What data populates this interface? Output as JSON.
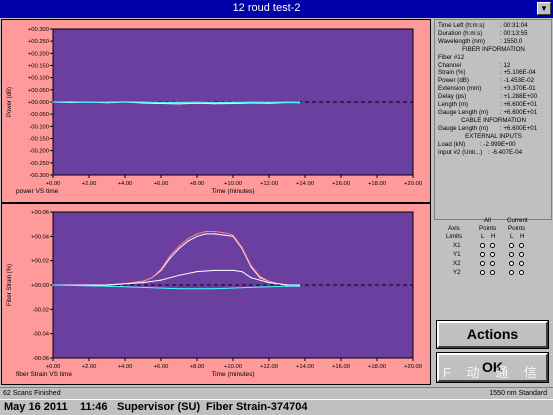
{
  "window": {
    "title": "12 roud test-2"
  },
  "top_chart": {
    "caption": "power VS time",
    "ylabel": "Power (dB)",
    "xlabel": "Time (minutes)",
    "yticks": [
      "+00.300",
      "+00.250",
      "+00.200",
      "+00.150",
      "+00.100",
      "+00.050",
      "+00.000",
      "-00.050",
      "-00.100",
      "-00.150",
      "-00.200",
      "-00.250",
      "-00.300"
    ],
    "xticks": [
      "+0.00",
      "+2.00",
      "+4.00",
      "+6.00",
      "+8.00",
      "+10.00",
      "+12.00",
      "+14.00",
      "+16.00",
      "+18.00",
      "+20.00"
    ]
  },
  "bottom_chart": {
    "caption": "fiber Strain VS time",
    "ylabel": "Fiber Strain (%)",
    "xlabel": "Time (minutes)",
    "yticks": [
      "+00.06",
      "+00.04",
      "+00.02",
      "+00.00",
      "-00.02",
      "-00.04",
      "-00.06"
    ],
    "xticks": [
      "+0.00",
      "+2.00",
      "+4.00",
      "+6.00",
      "+8.00",
      "+10.00",
      "+12.00",
      "+14.00",
      "+16.00",
      "+18.00",
      "+20.00"
    ]
  },
  "chart_data": [
    {
      "type": "line",
      "ylabel": "Power (dB)",
      "xlabel": "Time (minutes)",
      "xlim": [
        0,
        20
      ],
      "ylim": [
        -0.3,
        0.3
      ],
      "series": [
        {
          "color": "#ffffff",
          "x": [
            0,
            1,
            2,
            3,
            4,
            5,
            6,
            7,
            8,
            9,
            10,
            11,
            12,
            13,
            13.7
          ],
          "values": [
            0.0,
            -0.002,
            0.0,
            -0.003,
            0.0,
            -0.004,
            -0.006,
            -0.008,
            -0.005,
            -0.007,
            -0.006,
            -0.004,
            -0.005,
            -0.002,
            -0.003
          ]
        },
        {
          "color": "#ff8080",
          "x": [
            0,
            1,
            2,
            3,
            4,
            5,
            6,
            7,
            8,
            9,
            10,
            11,
            12,
            13,
            13.7
          ],
          "values": [
            0.0,
            0.001,
            0.0,
            -0.001,
            0.001,
            0.0,
            -0.002,
            -0.001,
            0.0,
            -0.002,
            -0.001,
            0.0,
            -0.001,
            0.0,
            0.0
          ]
        },
        {
          "color": "#40ffff",
          "x": [
            0,
            2,
            4,
            6,
            8,
            10,
            12,
            13.7
          ],
          "values": [
            0.0,
            -0.001,
            0.0,
            -0.002,
            -0.003,
            -0.002,
            -0.001,
            -0.002
          ]
        }
      ]
    },
    {
      "type": "line",
      "ylabel": "Fiber Strain (%)",
      "xlabel": "Time (minutes)",
      "xlim": [
        0,
        20
      ],
      "ylim": [
        -0.06,
        0.06
      ],
      "series": [
        {
          "color": "#ffffff",
          "x": [
            0,
            3,
            4,
            5,
            5.5,
            6,
            6.5,
            7,
            7.5,
            8,
            8.5,
            9,
            9.5,
            10,
            10.5,
            11,
            11.5,
            12,
            12.5,
            13,
            13.7
          ],
          "values": [
            0,
            0,
            0.001,
            0.003,
            0.006,
            0.012,
            0.022,
            0.03,
            0.036,
            0.04,
            0.042,
            0.042,
            0.041,
            0.04,
            0.03,
            0.015,
            0.006,
            0.003,
            0.001,
            0,
            0
          ]
        },
        {
          "color": "#ff8080",
          "x": [
            0,
            3,
            4,
            5,
            5.5,
            6,
            6.5,
            7,
            7.5,
            8,
            8.5,
            9,
            9.5,
            10,
            10.5,
            11,
            11.5,
            12,
            12.5,
            13,
            13.7
          ],
          "values": [
            0,
            0,
            0.001,
            0.003,
            0.006,
            0.013,
            0.024,
            0.032,
            0.038,
            0.042,
            0.044,
            0.044,
            0.043,
            0.041,
            0.031,
            0.016,
            0.007,
            0.003,
            0.001,
            0,
            0
          ]
        },
        {
          "color": "#ffffff",
          "x": [
            0,
            3,
            4,
            5,
            6,
            7,
            8,
            9,
            10,
            10.5,
            11,
            12,
            13,
            13.7
          ],
          "values": [
            0,
            0,
            0.001,
            0.002,
            0.004,
            0.008,
            0.011,
            0.012,
            0.012,
            0.011,
            0.006,
            0.002,
            0,
            0
          ]
        },
        {
          "color": "#40ffff",
          "x": [
            0,
            3,
            5,
            7,
            9,
            11,
            13,
            13.7
          ],
          "values": [
            0,
            -0.001,
            -0.002,
            -0.003,
            -0.003,
            -0.002,
            -0.001,
            -0.001
          ]
        }
      ]
    }
  ],
  "info": {
    "time_left_label": "Time Left (h:m:s)",
    "time_left": ": 00:31:04",
    "duration_label": "Duration (h:m:s)",
    "duration": ": 00:13:55",
    "wavelength_label": "Wavelength (nm)",
    "wavelength": ": 1550.0",
    "fiber_header": "FIBER INFORMATION",
    "fiber_num": "Fiber #12",
    "channel_label": "Channel",
    "channel": ": 12",
    "strain_label": "Strain (%)",
    "strain": ": +5.106E-04",
    "power_label": "Power (dB)",
    "power": ": -1.453E-02",
    "extension_label": "Extension (mm)",
    "extension": ": +3.370E-01",
    "delay_label": "Delay (ps)",
    "delay": ": +1.288E+00",
    "length_label": "Length (m)",
    "length": ": +6.600E+01",
    "gauge_label": "Gauge Length (m)",
    "gauge": ": +6.600E+01",
    "cable_header": "CABLE INFORMATION",
    "cable_gauge_label": "Gauge Length (m)",
    "cable_gauge": ": +6.600E+01",
    "ext_header": "EXTERNAL INPUTS",
    "load_label": "Load (kN)",
    "load": ": -2.999E+00",
    "input2_label": "Input #2 (Unit...)",
    "input2": ": -6.407E-04"
  },
  "axis_limits": {
    "axis": "Axis",
    "limits": "Limits",
    "all": "All",
    "current": "Current",
    "points1": "Points",
    "points2": "Points",
    "l": "L",
    "h": "H",
    "rows": [
      "X1",
      "Y1",
      "X2",
      "Y2"
    ]
  },
  "buttons": {
    "actions": "Actions",
    "ok": "OK"
  },
  "status": {
    "scans": "62 Scans Finished",
    "standard": "1550 nm Standard"
  },
  "footer": {
    "date": "May 16 2011",
    "time": "11:46",
    "user": "Supervisor (SU)",
    "mode": "Fiber Strain-374704"
  },
  "watermark": {
    "text": "F 动 通 信"
  }
}
